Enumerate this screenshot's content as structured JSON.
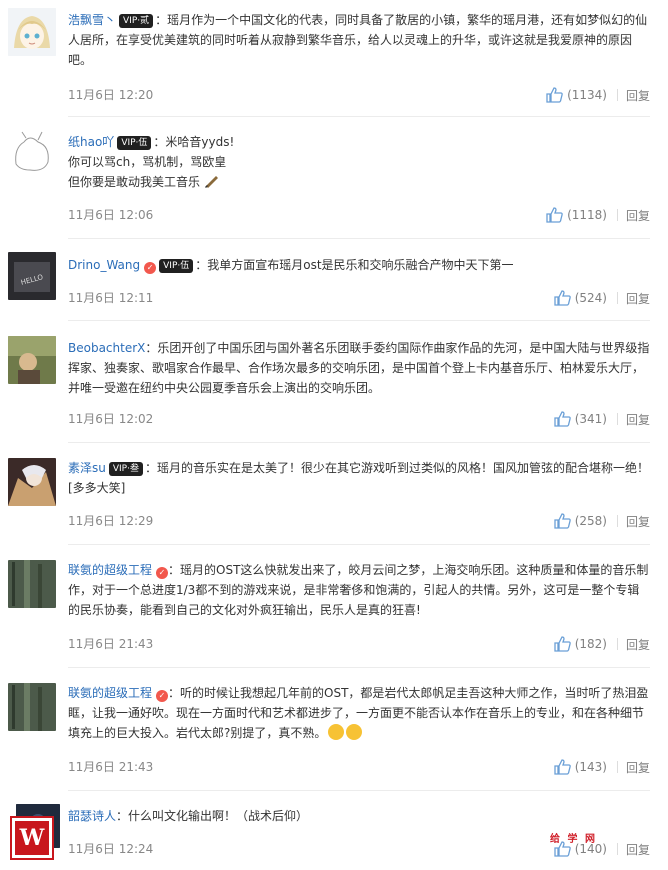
{
  "comments": [
    {
      "user": "浩飘雪丶",
      "vip": "VIP·贰",
      "text": "：瑶月作为一个中国文化的代表，同时具备了散居的小镇，繁华的瑶月港，还有如梦似幻的仙人居所，在享受优美建筑的同时听着从寂静到繁华音乐，给人以灵魂上的升华，或许这就是我爱原神的原因吧。",
      "time": "11月6日 12:20",
      "likes": "(1134)",
      "reply": "回复"
    },
    {
      "user": "纸hao吖",
      "vip": "VIP·伍",
      "text_lines": [
        "：米哈音yyds!",
        "你可以骂ch，骂机制，骂欧皇",
        "但你要是敢动我美工音乐"
      ],
      "time": "11月6日 12:06",
      "likes": "(1118)",
      "reply": "回复"
    },
    {
      "user": "Drino_Wang",
      "vip": "VIP·伍",
      "text": "：我单方面宣布瑶月ost是民乐和交响乐融合产物中天下第一",
      "time": "11月6日 12:11",
      "likes": "(524)",
      "reply": "回复"
    },
    {
      "user": "BeobachterX",
      "text": "：乐团开创了中国乐团与国外著名乐团联手委约国际作曲家作品的先河，是中国大陆与世界级指挥家、独奏家、歌唱家合作最早、合作场次最多的交响乐团，是中国首个登上卡内基音乐厅、柏林爱乐大厅，并唯一受邀在纽约中央公园夏季音乐会上演出的交响乐团。",
      "time": "11月6日 12:02",
      "likes": "(341)",
      "reply": "回复"
    },
    {
      "user": "素泽su",
      "vip": "VIP·叁",
      "text": "：瑶月的音乐实在是太美了！很少在其它游戏听到过类似的风格！国风加管弦的配合堪称一绝！[多多大笑]",
      "time": "11月6日 12:29",
      "likes": "(258)",
      "reply": "回复"
    },
    {
      "user": "联氨的超级工程",
      "text": "：瑶月的OST这么快就发出来了，皎月云间之梦，上海交响乐团。这种质量和体量的音乐制作，对于一个总进度1/3都不到的游戏来说，是非常奢侈和饱满的，引起人的共情。另外，这可是一整个专辑的民乐协奏，能看到自己的文化对外疯狂输出，民乐人是真的狂喜!",
      "time": "11月6日 21:43",
      "likes": "(182)",
      "reply": "回复"
    },
    {
      "user": "联氨的超级工程",
      "text": "：听的时候让我想起几年前的OST，都是岩代太郎帆足圭吾这种大师之作，当时听了热泪盈眶，让我一通好吹。现在一方面时代和艺术都进步了，一方面更不能否认本作在音乐上的专业，和在各种细节填充上的巨大投入。岩代太郎?别提了，真不熟。",
      "time": "11月6日 21:43",
      "likes": "(143)",
      "reply": "回复"
    },
    {
      "user": "韶瑟诗人",
      "text": "：什么叫文化输出啊！（战术后仰）",
      "time": "11月6日 12:24",
      "likes": "(140)",
      "reply": "回复"
    }
  ],
  "watermark": "给 学 网",
  "logo_letter": "W"
}
